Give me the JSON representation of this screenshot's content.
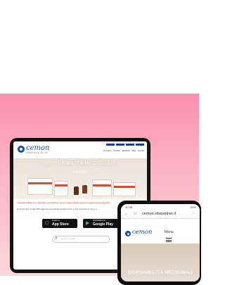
{
  "tablet": {
    "logo": "cemon",
    "logo_tagline": "OMEOPATIA E SALUTE",
    "nav_items": [
      "Chi siamo",
      "Prodotti",
      "Medicinali",
      "Blog",
      "Contatti"
    ],
    "hero_title": "DISPONIBILITÀ MEDICINALI",
    "hero_subtitle": "CEMON",
    "notice": "I medicinali indicati come \"disponibili su prenotazione\" possono essere ordinati e saranno consegnati appena disponibili.",
    "body_text": "Scopri ogni giorno la disponibilità aggiornata dei medicinali omeopatici Cemon e trova la farmacia più vicina a te.",
    "app_store": {
      "small": "Scarica su",
      "big": "App Store"
    },
    "google_play": {
      "small": "DISPONIBILE SU",
      "big": "Google Play"
    },
    "search_placeholder": "Cerca un rimedio"
  },
  "phone": {
    "time": "10:36",
    "status_right": "62%",
    "url": "cemon.rdepartner.it",
    "logo": "cemon",
    "menu_label": "Menu",
    "hero_title": "DISPONIBILITÀ MEDICINALI"
  },
  "colors": {
    "brand_blue": "#1a4aa3",
    "background_pink": "#fb8faf",
    "notice_red": "#d92222"
  }
}
